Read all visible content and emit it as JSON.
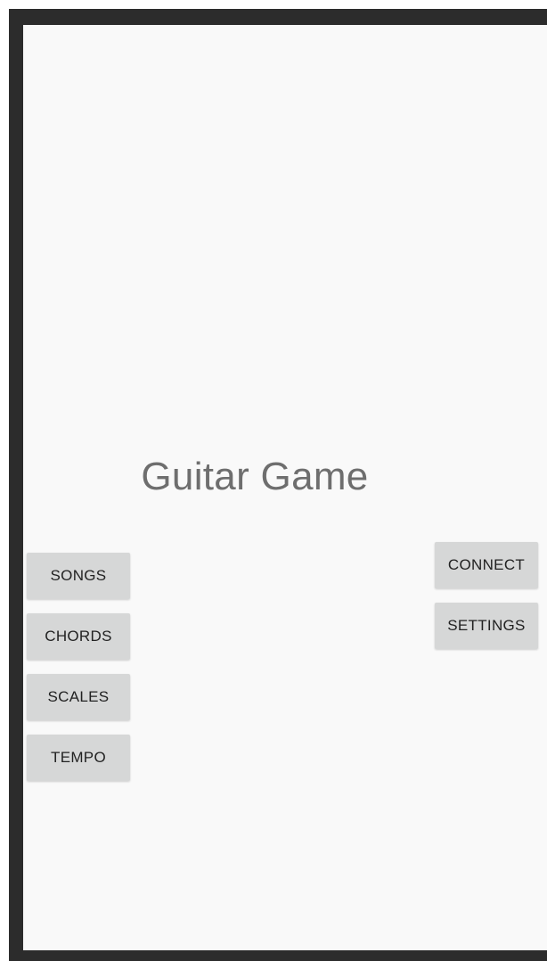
{
  "app": {
    "title": "Guitar Game"
  },
  "left_menu": {
    "items": [
      {
        "label": "SONGS"
      },
      {
        "label": "CHORDS"
      },
      {
        "label": "SCALES"
      },
      {
        "label": "TEMPO"
      }
    ]
  },
  "right_menu": {
    "items": [
      {
        "label": "CONNECT"
      },
      {
        "label": "SETTINGS"
      }
    ]
  },
  "colors": {
    "background": "#f9f9f9",
    "button": "#d6d7d7",
    "title_text": "#6e6e6e",
    "frame": "#2c2c2c"
  }
}
